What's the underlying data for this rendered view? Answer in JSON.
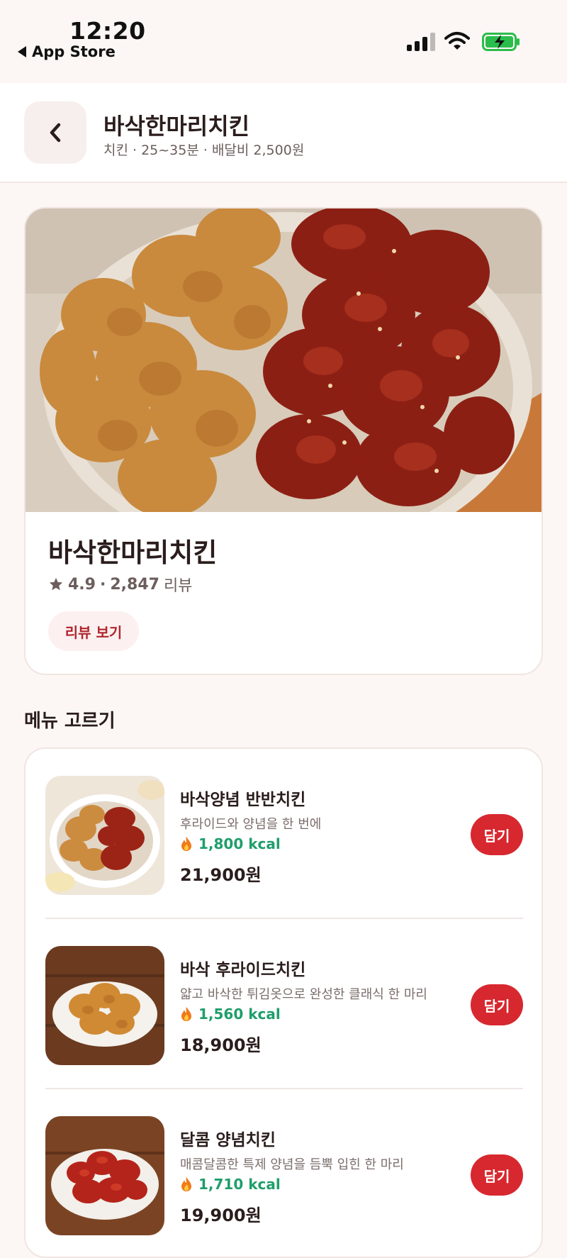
{
  "status_bar": {
    "time": "12:20",
    "back_app": "App Store"
  },
  "header": {
    "title": "바삭한마리치킨",
    "subtitle": "치킨 · 25~35분 · 배달비 2,500원"
  },
  "hero": {
    "name": "바삭한마리치킨",
    "rating": "4.9",
    "review_count": "2,847",
    "review_label": "리뷰",
    "review_button": "리뷰 보기"
  },
  "menu": {
    "section_title": "메뉴 고르기",
    "add_label": "담기",
    "items": [
      {
        "name": "바삭양념 반반치킨",
        "desc": "후라이드와 양념을 한 번에",
        "kcal": "1,800 kcal",
        "price": "21,900원"
      },
      {
        "name": "바삭 후라이드치킨",
        "desc": "얇고 바삭한 튀김옷으로 완성한 클래식 한 마리",
        "kcal": "1,560 kcal",
        "price": "18,900원"
      },
      {
        "name": "달콤 양념치킨",
        "desc": "매콤달콤한 특제 양념을 듬뿍 입힌 한 마리",
        "kcal": "1,710 kcal",
        "price": "19,900원"
      }
    ]
  },
  "colors": {
    "background": "#fcf7f4",
    "accent": "#d7282f",
    "kcal": "#1f9e6b",
    "review_btn_bg": "#fdf0f0"
  },
  "icons": [
    "back-chevron-icon",
    "star-icon",
    "flame-icon",
    "signal-icon",
    "wifi-icon",
    "battery-charging-icon"
  ]
}
